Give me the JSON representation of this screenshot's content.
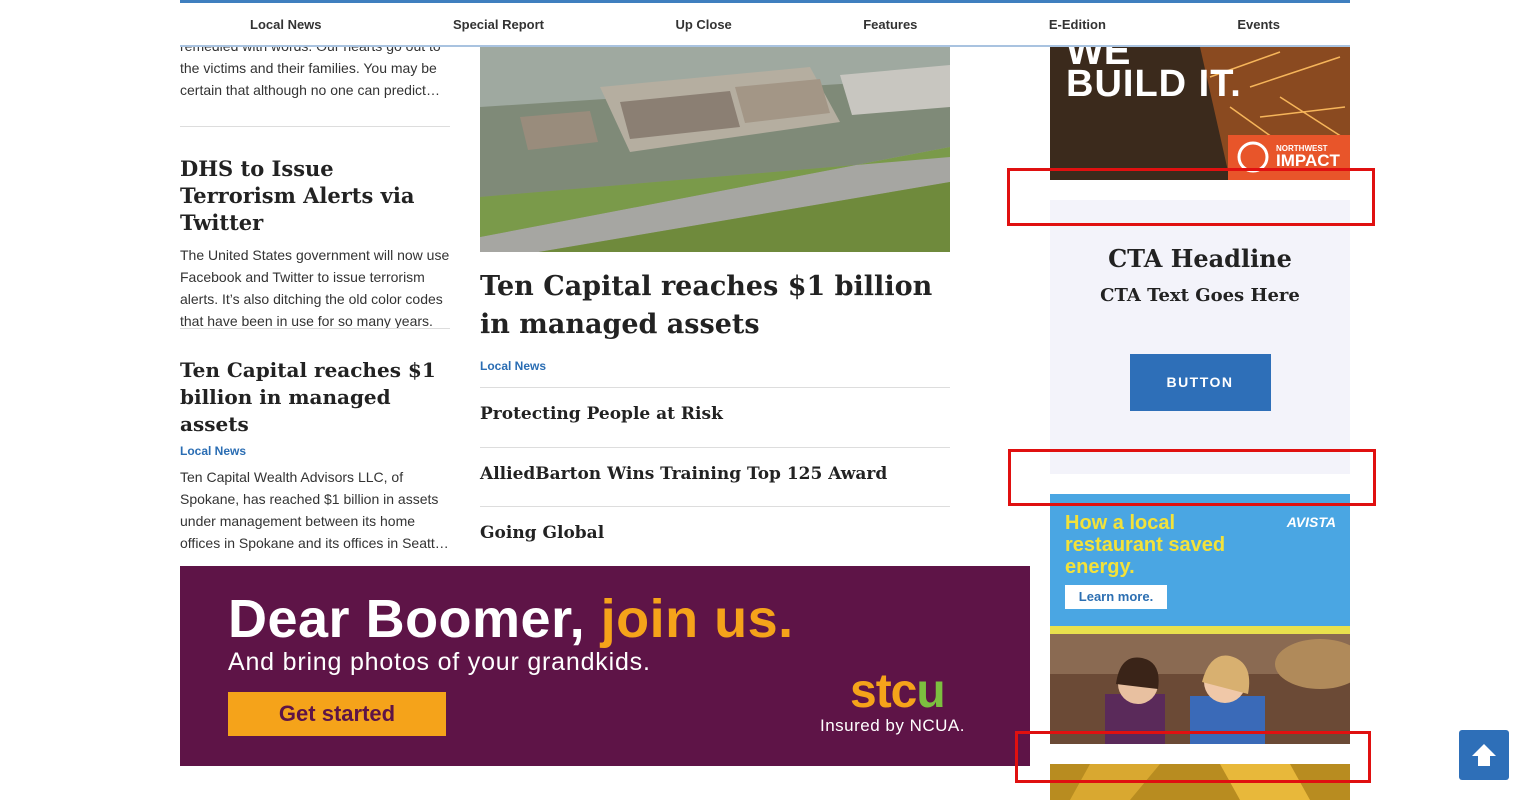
{
  "nav": {
    "items": [
      "Local News",
      "Special Report",
      "Up Close",
      "Features",
      "E-Edition",
      "Events"
    ]
  },
  "left_column": {
    "top_excerpt": "remedied with words. Our hearts go out to the victims and their families. You may be certain that although no one can predict…",
    "articles": [
      {
        "title": "DHS to Issue Terrorism Alerts via Twitter",
        "excerpt": "The United States government will now use Facebook and Twitter to issue terrorism alerts. It’s also ditching the old color codes that have been in use for so many years."
      },
      {
        "title": "Ten Capital reaches $1 billion in managed assets",
        "category": "Local News",
        "excerpt": "Ten Capital Wealth Advisors LLC, of Spokane, has reached $1 billion in assets under management between its home offices in Spokane and its offices in Seatt…"
      }
    ]
  },
  "main_story": {
    "title": "Ten Capital reaches $1 billion in managed assets",
    "category": "Local News",
    "related": [
      "Protecting People at Risk",
      "AlliedBarton Wins Training Top 125 Award",
      "Going Global"
    ]
  },
  "ads": {
    "top_right": {
      "headline": "BUILD IT.",
      "partial": "WE",
      "brand_top": "NORTHWEST",
      "brand": "IMPACT"
    },
    "cta": {
      "headline": "CTA Headline",
      "text": "CTA Text Goes Here",
      "button": "BUTTON"
    },
    "avista": {
      "headline": "How a local restaurant saved energy.",
      "logo": "AVISTA",
      "button": "Learn more."
    },
    "stcu": {
      "headline_part1": "Dear Boomer,",
      "headline_part2": "join us.",
      "subline": "And bring photos of your grandkids.",
      "button": "Get started",
      "logo_a": "stc",
      "logo_b": "u",
      "ncua": "Insured by NCUA."
    }
  },
  "colors": {
    "accent_blue": "#2e6fb8",
    "stcu_purple": "#5e1447",
    "stcu_orange": "#f5a31a",
    "annotation_red": "#e01010"
  },
  "icons": {
    "scroll_top": "arrow-up-icon"
  }
}
